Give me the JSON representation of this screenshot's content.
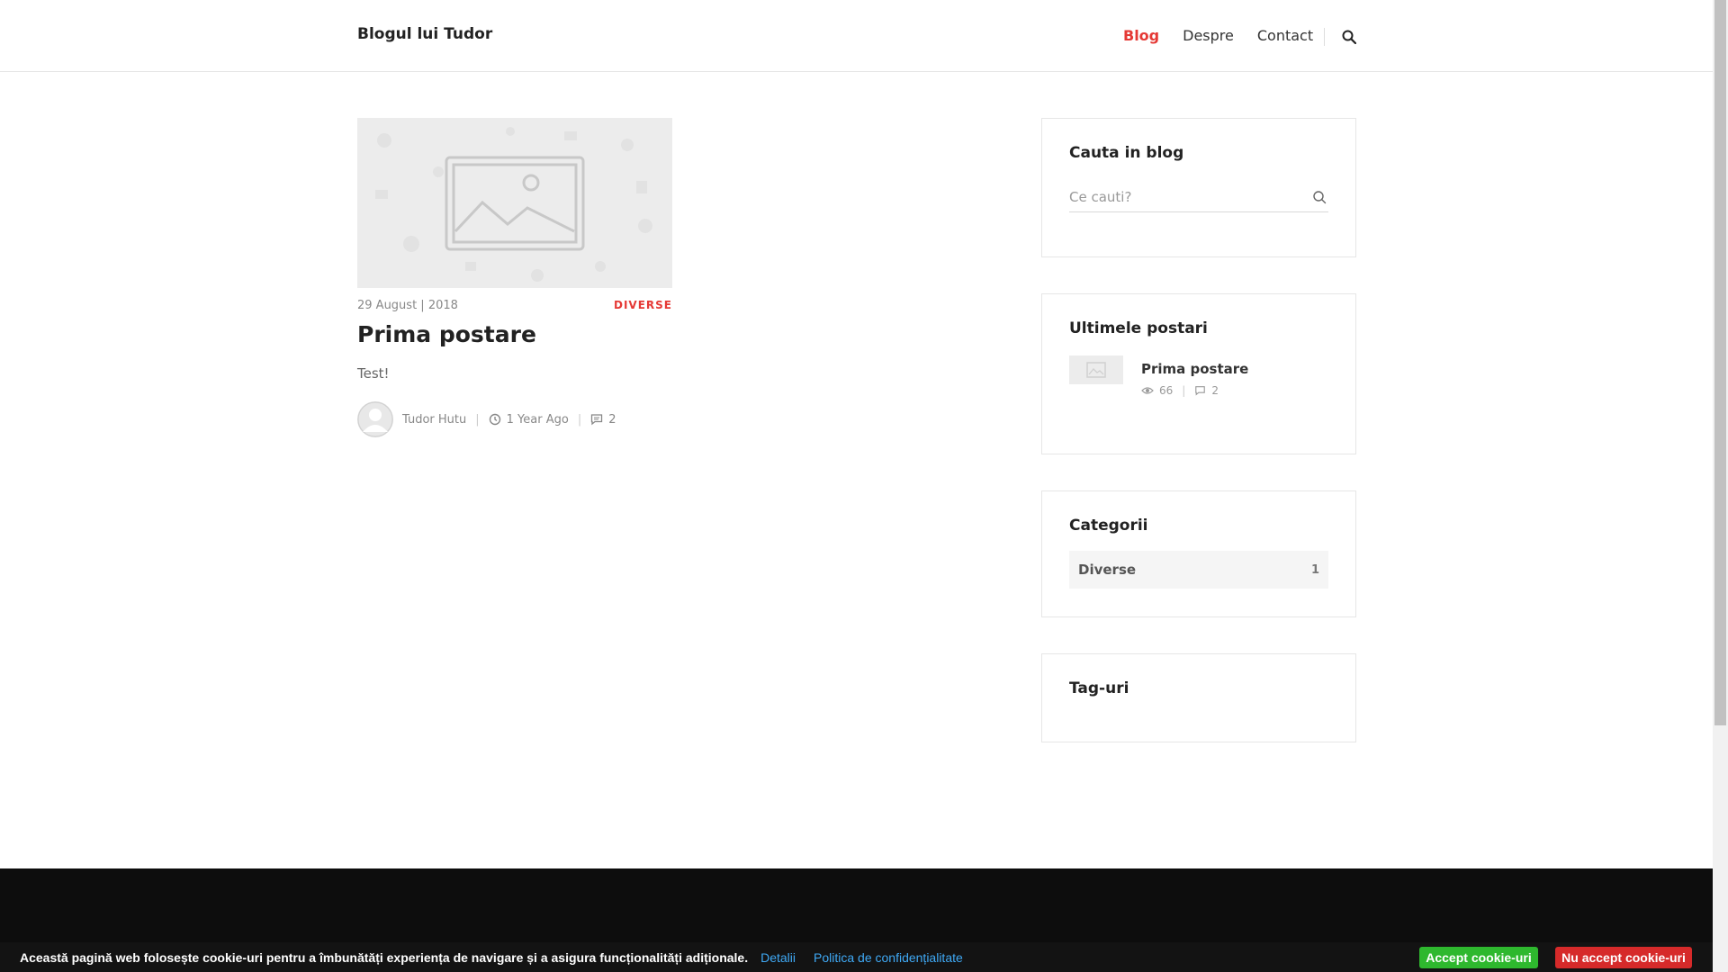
{
  "header": {
    "logo": "Blogul lui Tudor",
    "nav": [
      {
        "label": "Blog",
        "active": true
      },
      {
        "label": "Despre",
        "active": false
      },
      {
        "label": "Contact",
        "active": false
      }
    ],
    "search_icon": "search-icon"
  },
  "post": {
    "date": "29 August | 2018",
    "category": "DIVERSE",
    "title": "Prima postare",
    "excerpt": "Test!",
    "author": "Tudor Hutu",
    "time_ago": "1 Year Ago",
    "comments": "2"
  },
  "sidebar": {
    "search": {
      "title": "Cauta in blog",
      "placeholder": "Ce cauti?"
    },
    "recent": {
      "title": "Ultimele postari",
      "items": [
        {
          "title": "Prima postare",
          "views": "66",
          "comments": "2"
        }
      ]
    },
    "categories": {
      "title": "Categorii",
      "items": [
        {
          "name": "Diverse",
          "count": "1"
        }
      ]
    },
    "tags": {
      "title": "Tag-uri"
    }
  },
  "cookie": {
    "text": "Această pagină web folosește cookie-uri pentru a îmbunătăți experiența de navigare și a asigura funcționalități adiționale.",
    "details_link": "Detalii",
    "privacy_link": "Politica de confidențialitate",
    "accept": "Accept cookie-uri",
    "reject": "Nu accept cookie-uri"
  },
  "colors": {
    "accent": "#e53935",
    "accept_btn": "#2eb82e",
    "reject_btn": "#d62a2a",
    "footer_bg": "#0d0d0d",
    "link": "#3fa9f5"
  }
}
